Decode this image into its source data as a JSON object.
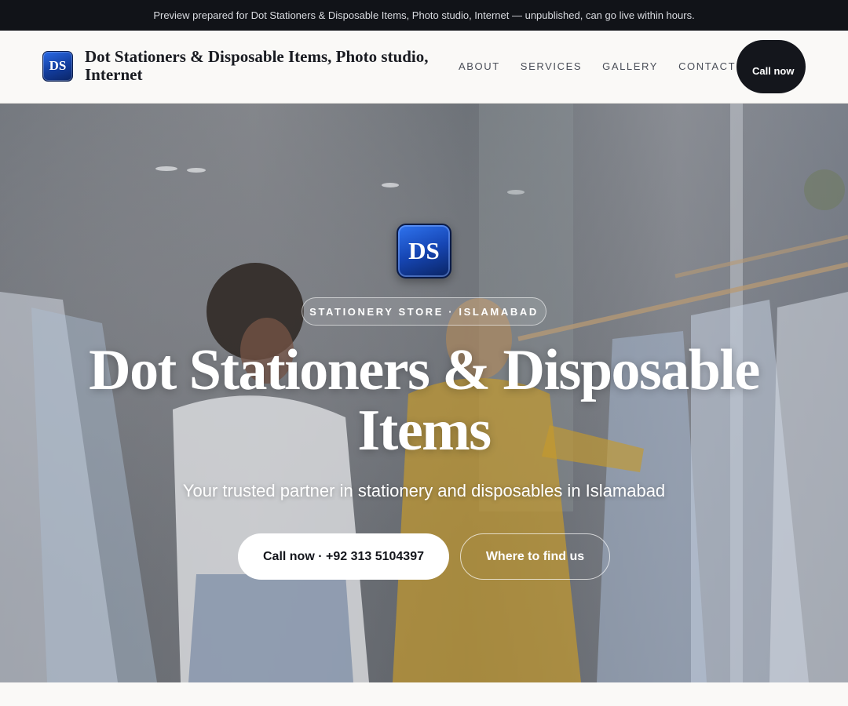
{
  "banner": {
    "text": "Preview prepared for Dot Stationers & Disposable Items, Photo studio, Internet — unpublished, can go live within hours."
  },
  "header": {
    "logo_text": "DS",
    "brand_name": "Dot Stationers & Disposable Items, Photo studio, Internet",
    "nav": [
      "ABOUT",
      "SERVICES",
      "GALLERY",
      "CONTACT"
    ],
    "call_label": "Call now"
  },
  "hero": {
    "logo_text": "DS",
    "category_pill": "STATIONERY STORE · ISLAMABAD",
    "title": "Dot Stationers & Disposable Items",
    "subtitle": "Your trusted partner in stationery and disposables in Islamabad",
    "primary_cta": "Call now · +92 313 5104397",
    "secondary_cta": "Where to find us",
    "background_image": "clothing-store-shoppers-photo"
  },
  "colors": {
    "dark": "#111318",
    "logo_blue": "#1646b4",
    "page_bg": "#faf9f7",
    "white": "#ffffff"
  }
}
